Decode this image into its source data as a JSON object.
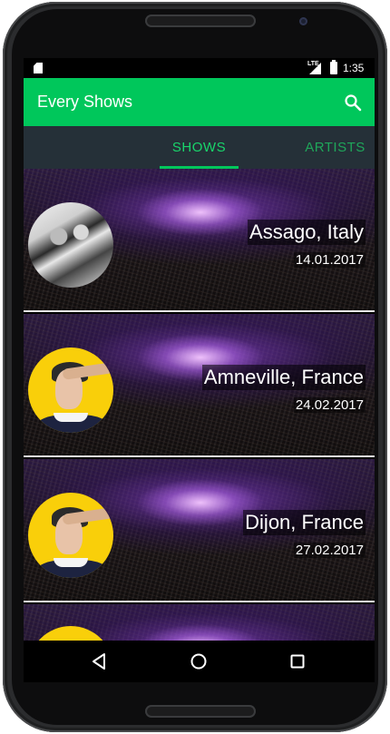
{
  "status_bar": {
    "network_label": "LTE",
    "time": "1:35",
    "icons": [
      "sd-card-icon",
      "signal-icon",
      "battery-icon"
    ]
  },
  "app_bar": {
    "title": "Every Shows",
    "search_icon": "search-icon",
    "color": "#00c75b"
  },
  "tabs": [
    {
      "label": "SHOWS",
      "selected": true
    },
    {
      "label": "ARTISTS",
      "selected": false
    }
  ],
  "shows": [
    {
      "place": "Assago, Italy",
      "date": "14.01.2017",
      "avatar": "bw-photo"
    },
    {
      "place": "Amneville, France",
      "date": "24.02.2017",
      "avatar": "yellow-portrait"
    },
    {
      "place": "Dijon, France",
      "date": "27.02.2017",
      "avatar": "yellow-portrait"
    }
  ],
  "nav_bar": {
    "icons": [
      "back-icon",
      "home-icon",
      "recents-icon"
    ]
  },
  "colors": {
    "accent": "#00c75b",
    "tab_bar": "#253038",
    "tab_selected_text": "#19d56b",
    "tab_unselected_text": "#1fa65a"
  }
}
